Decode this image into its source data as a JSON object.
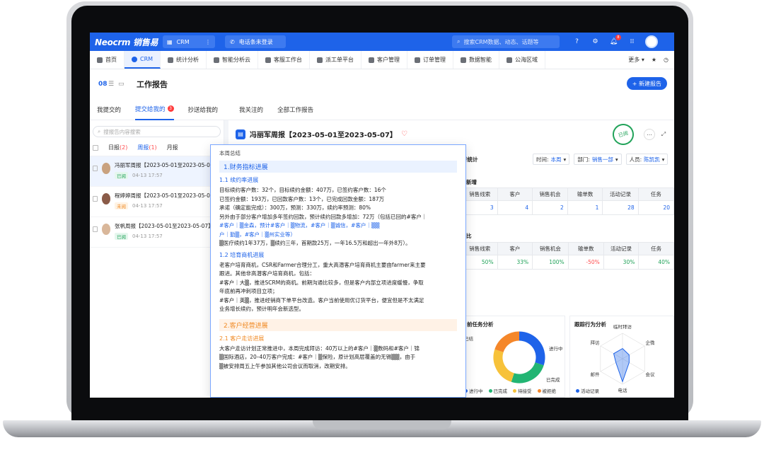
{
  "topbar": {
    "logo": "Neocrm 销售易",
    "crm_label": "CRM",
    "phone_label": "电话条未登录",
    "search_placeholder": "搜索CRM数据、动态、话题等",
    "notif_count": "8"
  },
  "nav": {
    "items": [
      {
        "label": "首页"
      },
      {
        "label": "CRM"
      },
      {
        "label": "统计分析"
      },
      {
        "label": "智能分析云"
      },
      {
        "label": "客服工作台"
      },
      {
        "label": "派工单平台"
      },
      {
        "label": "客户管理"
      },
      {
        "label": "订单管理"
      },
      {
        "label": "数据智能"
      },
      {
        "label": "公海区域"
      }
    ],
    "more": "更多"
  },
  "page": {
    "title": "工作报告",
    "new_button": "+ 新建报告",
    "view_grid": "08"
  },
  "subtabs": [
    {
      "label": "我提交的"
    },
    {
      "label": "提交给我的",
      "badge": "3"
    },
    {
      "label": "抄送给我的"
    },
    {
      "label": "我关注的"
    },
    {
      "label": "全部工作报告"
    }
  ],
  "left": {
    "search_placeholder": "搜报告内容搜索",
    "filters": {
      "daily": "日报",
      "daily_count": "(2)",
      "weekly": "周报",
      "weekly_count": "(1)",
      "monthly": "月报"
    },
    "items": [
      {
        "title": "冯丽军周报【2023-05-01至2023-05-07】",
        "status": "已阅",
        "time": "04-13 17:57"
      },
      {
        "title": "程婷婷周报【2023-05-01至2023-05-07】",
        "status": "未阅",
        "time": "04-13 17:57"
      },
      {
        "title": "张帆周报【2023-05-01至2023-05-07】",
        "status": "已阅",
        "time": "04-13 17:57"
      }
    ]
  },
  "report": {
    "title": "冯丽军周报【2023-05-01至2023-05-07】",
    "stamp": "已阅",
    "stats_label": "行统计",
    "filters": {
      "time_label": "时间:",
      "time_value": "本周",
      "dept_label": "部门:",
      "dept_value": "销售一部",
      "person_label": "人员:",
      "person_value": "陈凯凯"
    },
    "new_label": "新增",
    "ratio_label": "比",
    "headers": [
      "销售线索",
      "客户",
      "销售机会",
      "输单数",
      "活动记录",
      "任务"
    ],
    "new_values": [
      "3",
      "4",
      "2",
      "1",
      "28",
      "20"
    ],
    "ratio_values": [
      "50%",
      "33%",
      "100%",
      "-50%",
      "30%",
      "40%"
    ],
    "donut_title": "前任务分析",
    "donut_labels": {
      "left": "已结",
      "inprogress": "进行中",
      "done": "已完成"
    },
    "donut_legend": [
      "进行中",
      "已完成",
      "待接受",
      "被拒绝"
    ],
    "radar_title": "跟踪行为分析",
    "radar_labels": [
      "临时拜访",
      "企微",
      "会议",
      "电话",
      "邮件",
      "拜访"
    ],
    "radar_legend": "活动记录"
  },
  "chart_data": [
    {
      "type": "pie",
      "title": "前任务分析",
      "categories": [
        "进行中",
        "已完成",
        "待接受",
        "被拒绝"
      ],
      "values": [
        30,
        25,
        25,
        20
      ],
      "colors": [
        "#1e63e9",
        "#22b573",
        "#f7c23a",
        "#f5872a"
      ]
    },
    {
      "type": "radar",
      "title": "跟踪行为分析",
      "categories": [
        "临时拜访",
        "企微",
        "会议",
        "电话",
        "邮件",
        "拜访"
      ],
      "series": [
        {
          "name": "活动记录",
          "values": [
            2,
            1.5,
            1.5,
            4.5,
            1.5,
            2
          ]
        }
      ]
    }
  ],
  "popup": {
    "head": "本周总结",
    "s1": "1.财务指标进展",
    "s1_1": "1.1 续约率进展",
    "s1_1_lines": [
      "目标续约客户数：32个，目标续约金额：407万，已签约客户数：16个",
      "已签约金额：193万，已回款客户数：13个，已完成回款金额：187万",
      "承诺（确定能完成）：300万，预测：330万，续约率预测：80%",
      "另外由于部分客户增加多年签约回款，预计续约回款多增加：72万（包括已回的#客户｜",
      "#客户｜▒金森，预计#客户｜▒物流，#客户｜▒诚信，#客户｜▒▒",
      "户｜勤▒，#客户｜▒州实业等）",
      "▒医疗续约1年37万，▒续约三年，首期款25万，一年16.5万和超出一年外8万）。"
    ],
    "s1_2": "1.2 培育商机进展",
    "s1_2_lines": [
      "老客户培育商机，CSR和Farmer合理分工，重大高潜客户培育商机主要由farmer来主要",
      "跟进。其他非高潜客户培育商机，包括：",
      "#客户｜大▒，推进SCRM的商机。前期沟通比较多，但是客户内部立项进度缓慢，争取",
      "年底前再冲刺项目立项；",
      "#客户｜英▒，推进经销商下单平台改造。客户当前使用优订货平台，便宜但是不太满足",
      "业务增长续约，预计明年会新选型。"
    ],
    "s2": "2.客户经营进展",
    "s2_1": "2.1 客户走访进展",
    "s2_1_lines": [
      "大客户走访计划正常推进中，本周完成拜访：40万以上的#客户｜▒数码和#客户｜锦",
      "▒国际酒店，20–40万客户完成：#客户｜▒保险，原计划高层覆盖的无锡▒▒，由于",
      "▒被安排周五上午参加其他公司会议而取消，改期安排。"
    ]
  }
}
